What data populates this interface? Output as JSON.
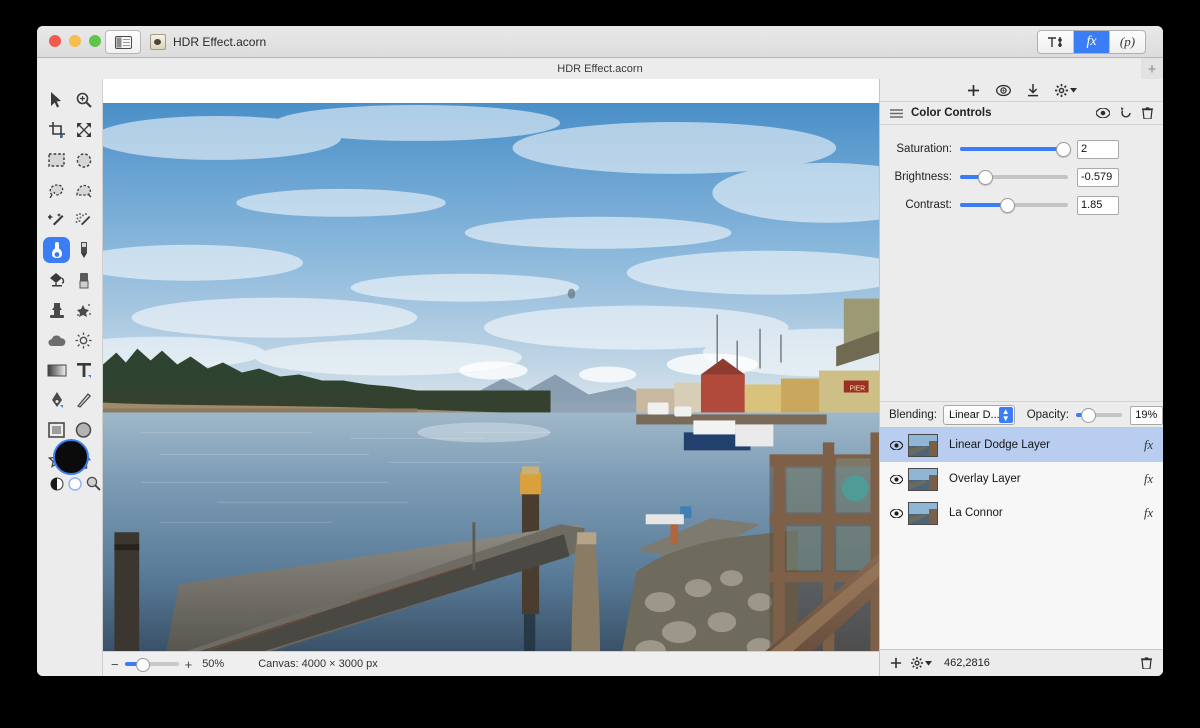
{
  "window": {
    "title": "HDR Effect.acorn",
    "tab_title": "HDR Effect.acorn",
    "traffic": {
      "close": "close-button",
      "minimize": "minimize-button",
      "zoom": "zoom-button"
    },
    "sidebar_toggle": "sidebar-toggle",
    "add_tab": "+"
  },
  "segmented": {
    "tools_label": "",
    "fx_label": "fx",
    "palette_label": "(p)",
    "selected": "fx",
    "accent": "#3b7df5"
  },
  "tools": {
    "items": [
      {
        "name": "move-tool",
        "selected": false
      },
      {
        "name": "zoom-tool",
        "selected": false
      },
      {
        "name": "crop-tool",
        "selected": false
      },
      {
        "name": "transform-tool",
        "selected": false
      },
      {
        "name": "rect-select-tool",
        "selected": false
      },
      {
        "name": "ellipse-select-tool",
        "selected": false
      },
      {
        "name": "lasso-tool",
        "selected": false
      },
      {
        "name": "polygon-lasso-tool",
        "selected": false
      },
      {
        "name": "magic-wand-tool",
        "selected": false
      },
      {
        "name": "instant-alpha-tool",
        "selected": false
      },
      {
        "name": "paint-brush-tool",
        "selected": true
      },
      {
        "name": "pencil-tool",
        "selected": false
      },
      {
        "name": "paint-bucket-tool",
        "selected": false
      },
      {
        "name": "eraser-tool",
        "selected": false
      },
      {
        "name": "clone-stamp-tool",
        "selected": false
      },
      {
        "name": "smudge-tool",
        "selected": false
      },
      {
        "name": "blur-tool",
        "selected": false
      },
      {
        "name": "dodge-tool",
        "selected": false
      },
      {
        "name": "gradient-tool",
        "selected": false
      },
      {
        "name": "text-tool",
        "selected": false
      },
      {
        "name": "pen-tool",
        "selected": false
      },
      {
        "name": "line-tool",
        "selected": false
      },
      {
        "name": "rectangle-shape-tool",
        "selected": false
      },
      {
        "name": "ellipse-shape-tool",
        "selected": false
      },
      {
        "name": "star-shape-tool",
        "selected": false
      },
      {
        "name": "arrow-shape-tool",
        "selected": false
      }
    ],
    "foreground_color": "#0b0b0b",
    "swap_icon": "swap-colors-icon",
    "background_icon": "background-color-icon",
    "picker_icon": "color-picker-icon"
  },
  "canvas": {
    "zoom_percent": "50%",
    "zoom_value": 50,
    "minus": "−",
    "plus": "+",
    "canvas_info": "Canvas: 4000 × 3000 px"
  },
  "filter_panel": {
    "toolbar_icons": [
      "add-filter-icon",
      "preview-filter-icon",
      "download-filter-icon",
      "filter-settings-icon"
    ],
    "filter": {
      "name": "Color Controls",
      "drag_handle": "filter-drag-handle",
      "actions": [
        "filter-visibility-icon",
        "filter-reset-icon",
        "filter-delete-icon"
      ],
      "controls": [
        {
          "label": "Saturation:",
          "value": "2",
          "fill": 100,
          "knob": 100
        },
        {
          "label": "Brightness:",
          "value": "-0.579",
          "fill": 22,
          "knob": 22
        },
        {
          "label": "Contrast:",
          "value": "1.85",
          "fill": 42,
          "knob": 42
        }
      ]
    }
  },
  "layer_panel": {
    "blending_label": "Blending:",
    "blending_value": "Linear D...",
    "opacity_label": "Opacity:",
    "opacity_value": "19%",
    "opacity_percent": 19,
    "layers": [
      {
        "name": "Linear Dodge Layer",
        "selected": true,
        "visible": true,
        "fx": "fx"
      },
      {
        "name": "Overlay Layer",
        "selected": false,
        "visible": true,
        "fx": "fx"
      },
      {
        "name": "La Connor",
        "selected": false,
        "visible": true,
        "fx": "fx"
      }
    ],
    "add_layer_icon": "add-layer-icon",
    "layer_settings_icon": "layer-settings-icon",
    "coordinates": "462,2816",
    "delete_layer_icon": "delete-layer-icon"
  }
}
